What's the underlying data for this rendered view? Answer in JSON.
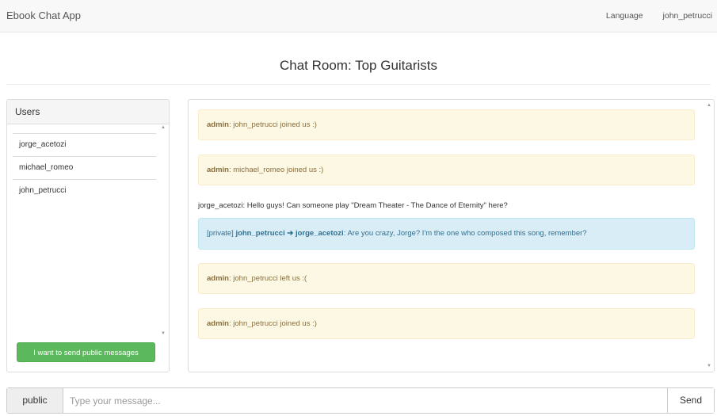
{
  "navbar": {
    "brand": "Ebook Chat App",
    "language": "Language",
    "user": "john_petrucci"
  },
  "page": {
    "title": "Chat Room: Top Guitarists"
  },
  "users": {
    "heading": "Users",
    "items": [
      "jorge_acetozi",
      "michael_romeo",
      "john_petrucci"
    ],
    "public_button": "I want to send public messages"
  },
  "messages": [
    {
      "type": "admin",
      "sender": "admin",
      "text": "john_petrucci joined us :)"
    },
    {
      "type": "admin",
      "sender": "admin",
      "text": "michael_romeo joined us :)"
    },
    {
      "type": "plain",
      "sender": "jorge_acetozi",
      "text": "Hello guys! Can someone play \"Dream Theater - The Dance of Eternity\" here?"
    },
    {
      "type": "private",
      "prefix": "[private]",
      "from": "john_petrucci",
      "arrow": "➔",
      "to": "jorge_acetozi",
      "text": "Are you crazy, Jorge? I'm the one who composed this song, remember?"
    },
    {
      "type": "admin",
      "sender": "admin",
      "text": "john_petrucci left us :("
    },
    {
      "type": "admin",
      "sender": "admin",
      "text": "john_petrucci joined us :)"
    }
  ],
  "input": {
    "scope_label": "public",
    "placeholder": "Type your message...",
    "value": "",
    "send_label": "Send"
  },
  "colors": {
    "admin_bg": "#fcf8e3",
    "private_bg": "#d9edf7",
    "public_button_bg": "#5cb85c"
  }
}
